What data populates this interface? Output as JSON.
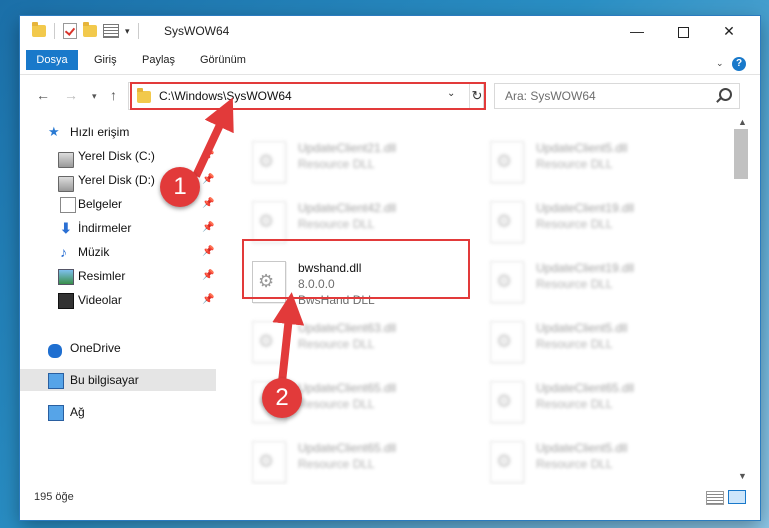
{
  "window": {
    "title": "SysWOW64"
  },
  "ribbon": {
    "tabs": [
      "Dosya",
      "Giriş",
      "Paylaş",
      "Görünüm"
    ],
    "help": "?"
  },
  "nav": {
    "address_path": "C:\\Windows\\SysWOW64",
    "search_placeholder": "Ara: SysWOW64"
  },
  "sidebar": {
    "items": [
      {
        "label": "Hızlı erişim"
      },
      {
        "label": "Yerel Disk (C:)"
      },
      {
        "label": "Yerel Disk (D:)"
      },
      {
        "label": "Belgeler"
      },
      {
        "label": "İndirmeler"
      },
      {
        "label": "Müzik"
      },
      {
        "label": "Resimler"
      },
      {
        "label": "Videolar"
      },
      {
        "label": "OneDrive"
      },
      {
        "label": "Bu bilgisayar"
      },
      {
        "label": "Ağ"
      }
    ]
  },
  "files": {
    "left": [
      {
        "name": "UpdateClient21.dll",
        "desc": "Resource DLL"
      },
      {
        "name": "UpdateClient42.dll",
        "desc": "Resource DLL"
      },
      {
        "name": "bwshand.dll",
        "version": "8.0.0.0",
        "desc": "BwsHand DLL"
      },
      {
        "name": "UpdateClient63.dll",
        "desc": "Resource DLL"
      },
      {
        "name": "UpdateClient65.dll",
        "desc": "Resource DLL"
      },
      {
        "name": "UpdateClient65.dll",
        "desc": "Resource DLL"
      }
    ],
    "right": [
      {
        "name": "UpdateClient5.dll",
        "desc": "Resource DLL"
      },
      {
        "name": "UpdateClient19.dll",
        "desc": "Resource DLL"
      },
      {
        "name": "UpdateClient19.dll",
        "desc": "Resource DLL"
      },
      {
        "name": "UpdateClient5.dll",
        "desc": "Resource DLL"
      },
      {
        "name": "UpdateClient65.dll",
        "desc": "Resource DLL"
      },
      {
        "name": "UpdateClient5.dll",
        "desc": "Resource DLL"
      }
    ]
  },
  "status": {
    "item_count": "195 öğe"
  },
  "annotations": {
    "step1": "1",
    "step2": "2",
    "color": "#e23a3a"
  }
}
